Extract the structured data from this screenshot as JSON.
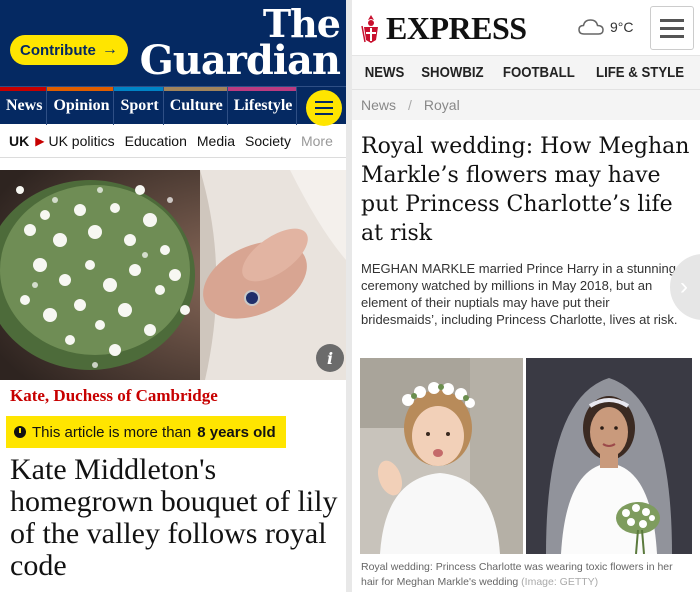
{
  "guardian": {
    "contribute_label": "Contribute",
    "logo_line1": "The",
    "logo_line2": "Guardian",
    "nav": [
      {
        "label": "News",
        "color": "#c70000"
      },
      {
        "label": "Opinion",
        "color": "#e05e00"
      },
      {
        "label": "Sport",
        "color": "#0084c6"
      },
      {
        "label": "Culture",
        "color": "#a1845c"
      },
      {
        "label": "Lifestyle",
        "color": "#bb3b80"
      }
    ],
    "subnav": {
      "current": "UK",
      "items": [
        "UK politics",
        "Education",
        "Media",
        "Society"
      ],
      "more": "More"
    },
    "photo_icon": "info-icon",
    "kicker": "Kate, Duchess of Cambridge",
    "age_prefix": "This article is more than",
    "age_value": "8 years old",
    "headline": "Kate Middleton's homegrown bouquet of lily of the valley follows royal code"
  },
  "express": {
    "logo_text": "EXPRESS",
    "weather_temp": "9°C",
    "weather_icon": "cloud-icon",
    "nav": [
      "NEWS",
      "SHOWBIZ",
      "FOOTBALL",
      "LIFE & STYLE"
    ],
    "breadcrumb": [
      "News",
      "Royal"
    ],
    "headline": "Royal wedding: How Meghan Markle’s flowers may have put Princess Charlotte’s life at risk",
    "standfirst": "MEGHAN MARKLE married Prince Harry in a stunning ceremony watched by millions in May 2018, but an element of their nuptials may have put their bridesmaids’, including Princess Charlotte, lives at risk.",
    "caption": "Royal wedding: Princess Charlotte was wearing toxic flowers in her hair for Meghan Markle's wedding",
    "caption_credit": "(Image: GETTY)"
  }
}
